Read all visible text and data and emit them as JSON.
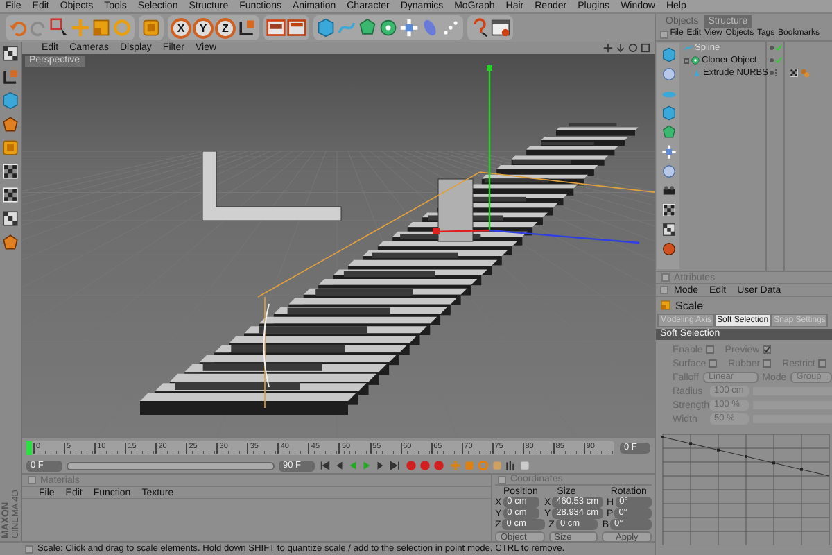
{
  "menu": [
    "File",
    "Edit",
    "Objects",
    "Tools",
    "Selection",
    "Structure",
    "Functions",
    "Animation",
    "Character",
    "Dynamics",
    "MoGraph",
    "Hair",
    "Render",
    "Plugins",
    "Window",
    "Help"
  ],
  "toolbar": {
    "axis_buttons": [
      {
        "label": "X",
        "on": true
      },
      {
        "label": "Y",
        "on": true
      },
      {
        "label": "Z",
        "on": true
      }
    ]
  },
  "viewport": {
    "menu": [
      "Edit",
      "Cameras",
      "Display",
      "Filter",
      "View"
    ],
    "camera": "Perspective"
  },
  "objects": {
    "tabs": [
      {
        "label": "Objects",
        "selected": true
      },
      {
        "label": "Structure",
        "selected": false
      }
    ],
    "menu": [
      "File",
      "Edit",
      "View",
      "Objects",
      "Tags",
      "Bookmarks"
    ],
    "tree": [
      {
        "name": "Spline",
        "enabled": true,
        "tagged": false
      },
      {
        "name": "Cloner Object",
        "enabled": true,
        "tagged": false,
        "children": [
          {
            "name": "Extrude NURBS",
            "enabled": false,
            "tagged": true
          }
        ]
      }
    ]
  },
  "attributes": {
    "title": "Attributes",
    "menu": [
      "Mode",
      "Edit",
      "User Data"
    ],
    "tool": "Scale",
    "tabs": [
      {
        "label": "Modeling Axis",
        "selected": false
      },
      {
        "label": "Soft Selection",
        "selected": true
      },
      {
        "label": "Snap Settings",
        "selected": false
      }
    ],
    "section": "Soft Selection",
    "disabled": true,
    "checks": [
      [
        {
          "label": "Enable",
          "checked": false
        },
        {
          "label": "Preview",
          "checked": true
        }
      ],
      [
        {
          "label": "Surface",
          "checked": false
        },
        {
          "label": "Rubber",
          "checked": false
        },
        {
          "label": "Restrict",
          "checked": false
        }
      ]
    ],
    "falloff": {
      "label": "Falloff",
      "value": "Linear"
    },
    "mode": {
      "label": "Mode",
      "value": "Group"
    },
    "sliders": [
      {
        "label": "Radius",
        "value": "100 cm"
      },
      {
        "label": "Strength",
        "value": "100 %"
      },
      {
        "label": "Width",
        "value": "50 %"
      }
    ]
  },
  "timeline": {
    "ticks": [
      "0",
      "5",
      "10",
      "15",
      "20",
      "25",
      "30",
      "35",
      "40",
      "45",
      "50",
      "55",
      "60",
      "65",
      "70",
      "75",
      "80",
      "85",
      "90"
    ],
    "current": "0 F",
    "start": "0 F",
    "end": "90 F",
    "level": 1
  },
  "materials": {
    "title": "Materials",
    "menu": [
      "File",
      "Edit",
      "Function",
      "Texture"
    ]
  },
  "coordinates": {
    "title": "Coordinates",
    "headers": [
      "Position",
      "Size",
      "Rotation"
    ],
    "rows": [
      {
        "axes": [
          "X",
          "X",
          "H"
        ],
        "values": [
          "0 cm",
          "460.53 cm",
          "0°"
        ]
      },
      {
        "axes": [
          "Y",
          "Y",
          "P"
        ],
        "values": [
          "0 cm",
          "28.934 cm",
          "0°"
        ]
      },
      {
        "axes": [
          "Z",
          "Z",
          "B"
        ],
        "values": [
          "0 cm",
          "0 cm",
          "0°"
        ]
      }
    ],
    "dropdowns": [
      "Object",
      "Size"
    ],
    "apply": "Apply"
  },
  "logo": [
    "MAXON",
    "CINEMA 4D"
  ],
  "status": "Scale: Click and drag to scale elements. Hold down SHIFT to quantize scale / add to the selection in point mode, CTRL to remove."
}
